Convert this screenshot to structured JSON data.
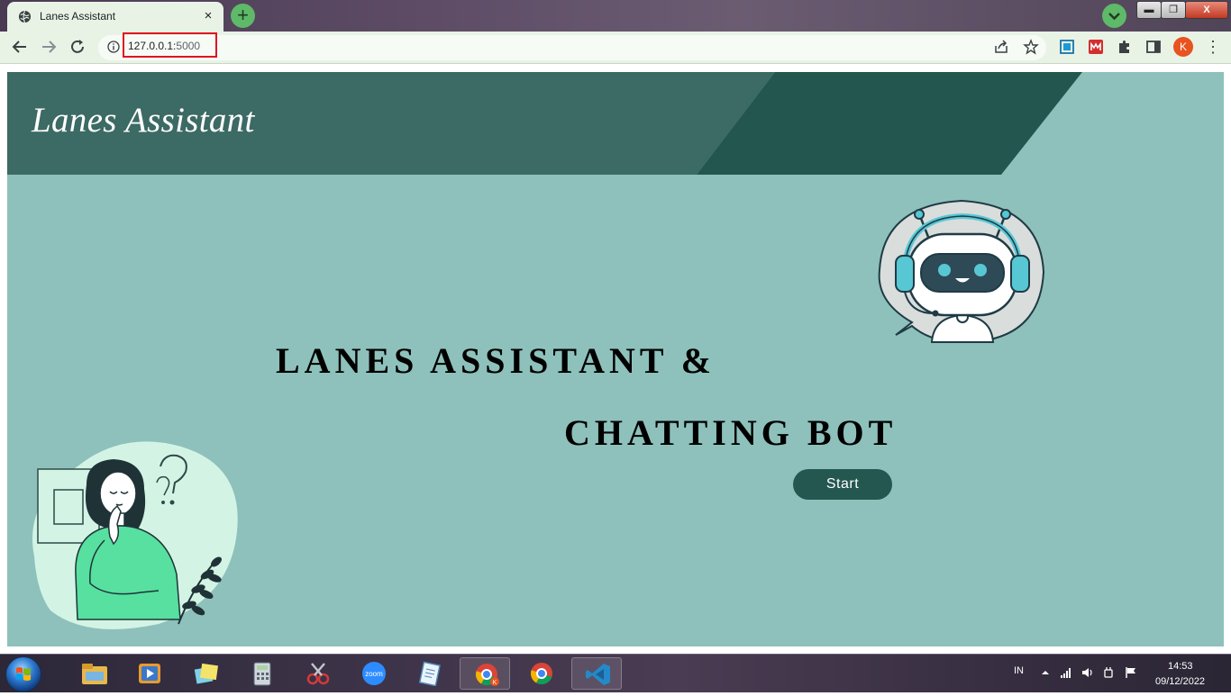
{
  "browser": {
    "tab_title": "Lanes Assistant",
    "tab_close": "×",
    "new_tab": "+",
    "url_host": "127.0.0.1:",
    "url_port": "5000",
    "profile_initial": "K",
    "menu": "⋮",
    "window_min": "▬",
    "window_max": "❐",
    "window_close": "X"
  },
  "page": {
    "brand": "Lanes Assistant",
    "hero_line1": "LANES ASSISTANT &",
    "hero_line2": "CHATTING BOT",
    "start_label": "Start"
  },
  "taskbar": {
    "language": "IN",
    "time": "14:53",
    "date": "09/12/2022",
    "apps": [
      "file-explorer",
      "media-player",
      "sticky-notes",
      "calculator",
      "snipping-tool",
      "zoom",
      "notepad",
      "chrome-profile-k",
      "chrome",
      "visual-studio-code"
    ]
  },
  "colors": {
    "page_bg": "#8ec1bb",
    "header_dark": "#3c6a64",
    "header_darker": "#23564f",
    "button_bg": "#245750",
    "browser_chrome": "#e8f3e6",
    "url_highlight": "#e0141e"
  }
}
